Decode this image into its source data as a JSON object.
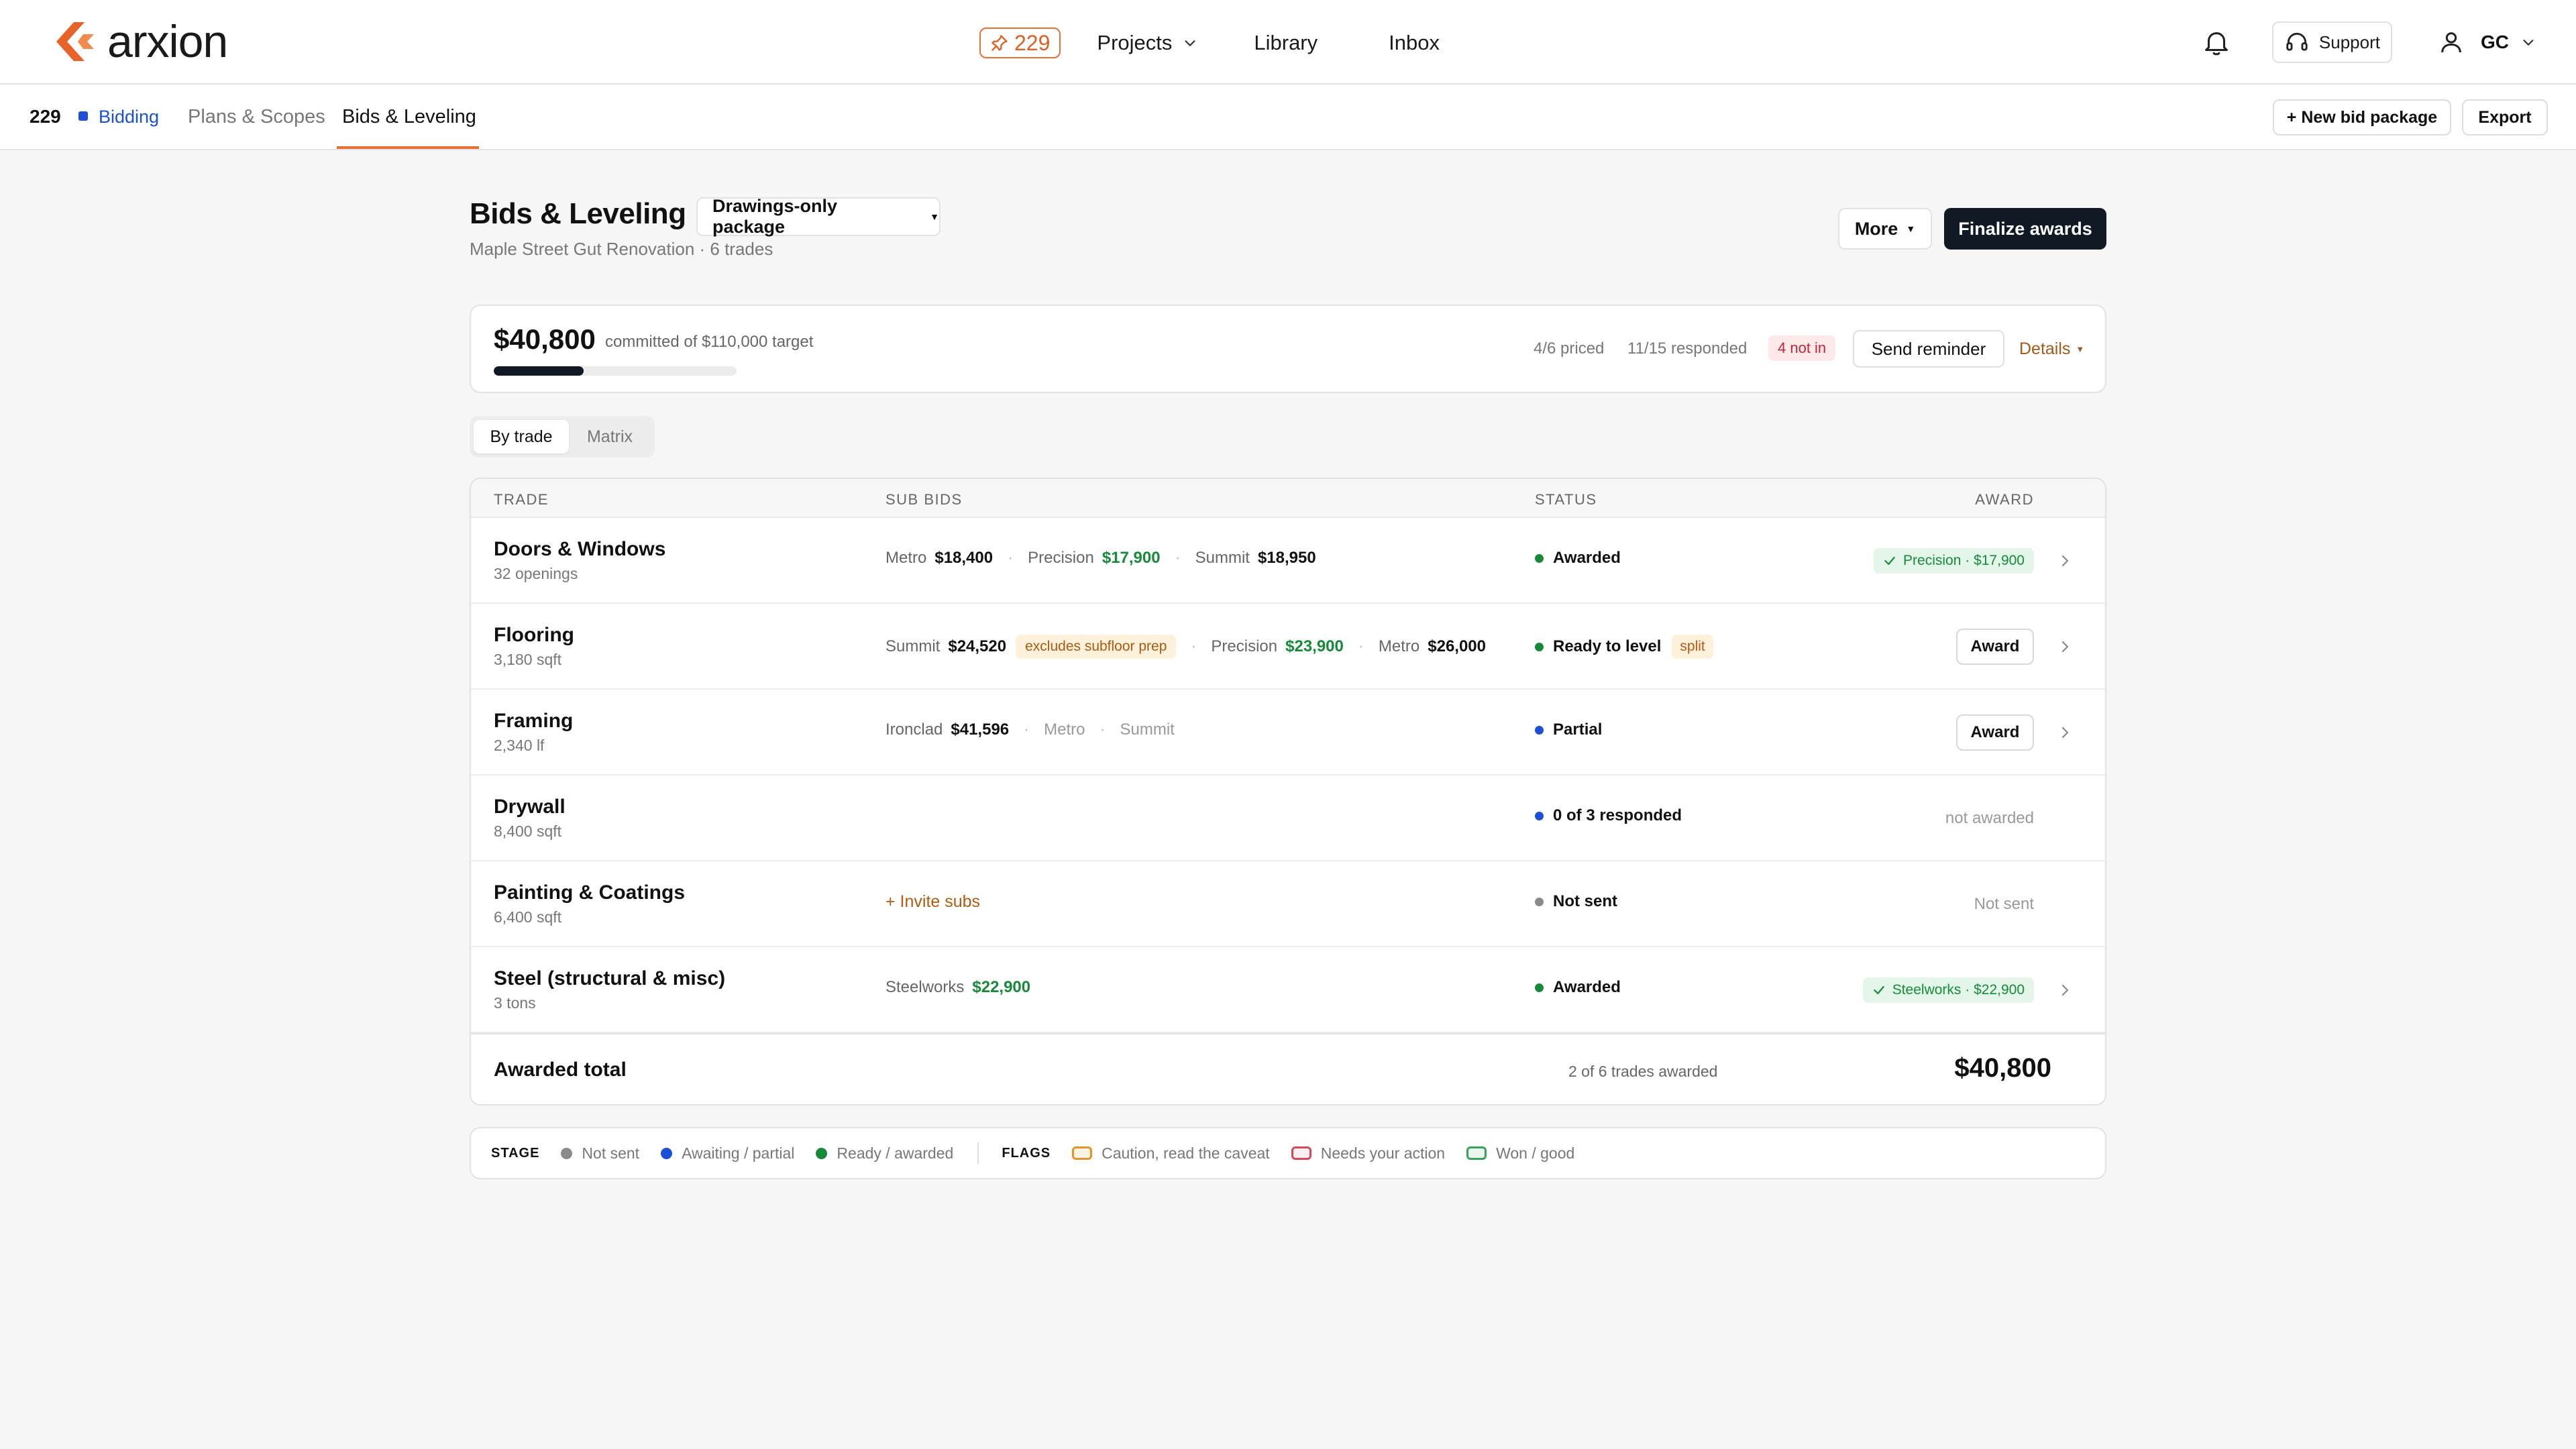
{
  "app": {
    "brand": "arxion",
    "pin_count": "229",
    "nav": {
      "projects": "Projects",
      "library": "Library",
      "inbox": "Inbox"
    },
    "support": "Support",
    "user": "GC"
  },
  "subbar": {
    "project_number": "229",
    "stage": "Bidding",
    "tabs": [
      "Plans & Scopes",
      "Bids & Leveling"
    ],
    "active_tab": "Bids & Leveling",
    "new_package": "+ New bid package",
    "export": "Export"
  },
  "page": {
    "title": "Bids & Leveling",
    "package": "Drawings-only package",
    "subtitle": "Maple Street Gut Renovation · 6 trades",
    "more": "More",
    "finalize": "Finalize awards"
  },
  "summary": {
    "committed": "$40,800",
    "target_text": "committed of $110,000 target",
    "progress_fraction": 0.371,
    "priced": "4/6 priced",
    "responded": "11/15 responded",
    "not_in": "4 not in",
    "send_reminder": "Send reminder",
    "details": "Details"
  },
  "view_toggle": {
    "by_trade": "By trade",
    "matrix": "Matrix",
    "active": "By trade"
  },
  "table": {
    "headers": {
      "trade": "TRADE",
      "sub_bids": "SUB BIDS",
      "status": "STATUS",
      "award": "AWARD"
    },
    "rows": [
      {
        "trade": "Doors & Windows",
        "qty": "32 openings",
        "bids": [
          {
            "name": "Metro",
            "amount": "$18,400"
          },
          {
            "name": "Precision",
            "amount": "$17,900",
            "low": true
          },
          {
            "name": "Summit",
            "amount": "$18,950"
          }
        ],
        "status": "Awarded",
        "status_color": "green",
        "award_chip": "Precision · $17,900"
      },
      {
        "trade": "Flooring",
        "qty": "3,180 sqft",
        "bids": [
          {
            "name": "Summit",
            "amount": "$24,520",
            "flag": "excludes subfloor prep"
          },
          {
            "name": "Precision",
            "amount": "$23,900",
            "low": true
          },
          {
            "name": "Metro",
            "amount": "$26,000"
          }
        ],
        "status": "Ready to level",
        "status_color": "green",
        "status_tag": "split",
        "award_button": "Award"
      },
      {
        "trade": "Framing",
        "qty": "2,340 lf",
        "bids": [
          {
            "name": "Ironclad",
            "amount": "$41,596"
          },
          {
            "name": "Metro",
            "muted": true
          },
          {
            "name": "Summit",
            "muted": true
          }
        ],
        "status": "Partial",
        "status_color": "blue",
        "award_button": "Award"
      },
      {
        "trade": "Drywall",
        "qty": "8,400 sqft",
        "bids": [],
        "status": "0 of 3 responded",
        "status_color": "blue",
        "award_text": "not awarded"
      },
      {
        "trade": "Painting & Coatings",
        "qty": "6,400 sqft",
        "bids": [],
        "invite": "+ Invite subs",
        "status": "Not sent",
        "status_color": "grey",
        "award_text": "Not sent"
      },
      {
        "trade": "Steel (structural & misc)",
        "qty": "3 tons",
        "bids": [
          {
            "name": "Steelworks",
            "amount": "$22,900",
            "low": true
          }
        ],
        "status": "Awarded",
        "status_color": "green",
        "award_chip": "Steelworks · $22,900"
      }
    ],
    "total": {
      "label": "Awarded total",
      "count": "2 of 6 trades awarded",
      "amount": "$40,800"
    }
  },
  "legend": {
    "stage_label": "STAGE",
    "stage_items": [
      {
        "label": "Not sent",
        "color": "#8a8a8a"
      },
      {
        "label": "Awaiting / partial",
        "color": "#1c4fd6"
      },
      {
        "label": "Ready / awarded",
        "color": "#178a3a"
      }
    ],
    "flags_label": "FLAGS",
    "flag_items": [
      {
        "label": "Caution, read the caveat",
        "color": "#e0962b",
        "fill": "#fdf3e2"
      },
      {
        "label": "Needs your action",
        "color": "#d2495b",
        "fill": "#fdeef0"
      },
      {
        "label": "Won / good",
        "color": "#3aa05c",
        "fill": "#eaf7ee"
      }
    ]
  },
  "colors": {
    "accent": "#e87036",
    "brand_dark": "#111a24",
    "good": "#178a3a",
    "stage_blue": "#1c4fd6",
    "warn": "#c2253a"
  }
}
